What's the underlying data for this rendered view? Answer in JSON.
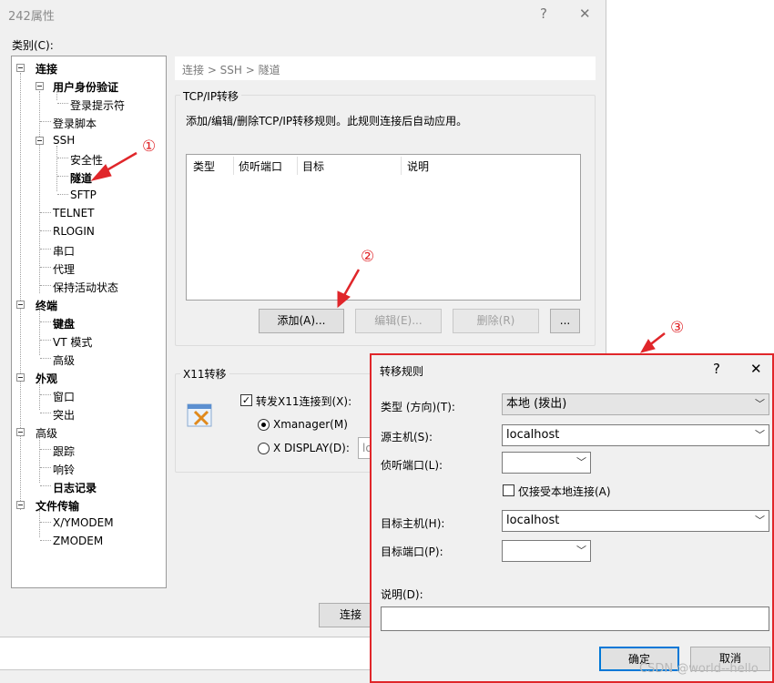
{
  "main_window": {
    "title": "242属性",
    "help_button": "?",
    "close_button": "✕",
    "category_label": "类别(C):"
  },
  "tree": {
    "items": [
      {
        "label": "连接"
      },
      {
        "label": "用户身份验证"
      },
      {
        "label": "登录提示符"
      },
      {
        "label": "登录脚本"
      },
      {
        "label": "SSH"
      },
      {
        "label": "安全性"
      },
      {
        "label": "隧道"
      },
      {
        "label": "SFTP"
      },
      {
        "label": "TELNET"
      },
      {
        "label": "RLOGIN"
      },
      {
        "label": "串口"
      },
      {
        "label": "代理"
      },
      {
        "label": "保持活动状态"
      },
      {
        "label": "终端"
      },
      {
        "label": "键盘"
      },
      {
        "label": "VT 模式"
      },
      {
        "label": "高级"
      },
      {
        "label": "外观"
      },
      {
        "label": "窗口"
      },
      {
        "label": "突出"
      },
      {
        "label": "高级"
      },
      {
        "label": "跟踪"
      },
      {
        "label": "响铃"
      },
      {
        "label": "日志记录"
      },
      {
        "label": "文件传输"
      },
      {
        "label": "X/YMODEM"
      },
      {
        "label": "ZMODEM"
      }
    ]
  },
  "breadcrumb": "连接 > SSH > 隧道",
  "tcp_group": {
    "title": "TCP/IP转移",
    "description": "添加/编辑/删除TCP/IP转移规则。此规则连接后自动应用。",
    "columns": [
      "类型",
      "侦听端口",
      "目标",
      "说明"
    ],
    "add_button": "添加(A)...",
    "edit_button": "编辑(E)...",
    "delete_button": "删除(R)",
    "more_button": "..."
  },
  "x11_group": {
    "title": "X11转移",
    "forward_checkbox": "转发X11连接到(X):",
    "xmanager_radio": "Xmanager(M)",
    "xdisplay_radio": "X DISPLAY(D):",
    "xdisplay_value": "lo"
  },
  "main_footer": {
    "connect_button": "连接"
  },
  "dialog": {
    "title": "转移规则",
    "help_button": "?",
    "close_button": "✕",
    "type_label": "类型 (方向)(T):",
    "type_value": "本地 (拨出)",
    "source_host_label": "源主机(S):",
    "source_host_value": "localhost",
    "listen_port_label": "侦听端口(L):",
    "listen_port_value": "",
    "local_only_label": "仅接受本地连接(A)",
    "target_host_label": "目标主机(H):",
    "target_host_value": "localhost",
    "target_port_label": "目标端口(P):",
    "target_port_value": "",
    "description_label": "说明(D):",
    "description_value": "",
    "ok_button": "确定",
    "cancel_button": "取消"
  },
  "annotations": {
    "one": "①",
    "two": "②",
    "three": "③"
  },
  "watermark": "CSDN @world--hello",
  "colors": {
    "annotation": "#e0262a",
    "window_bg": "#f0f0f0",
    "focus_border": "#0078d7"
  }
}
